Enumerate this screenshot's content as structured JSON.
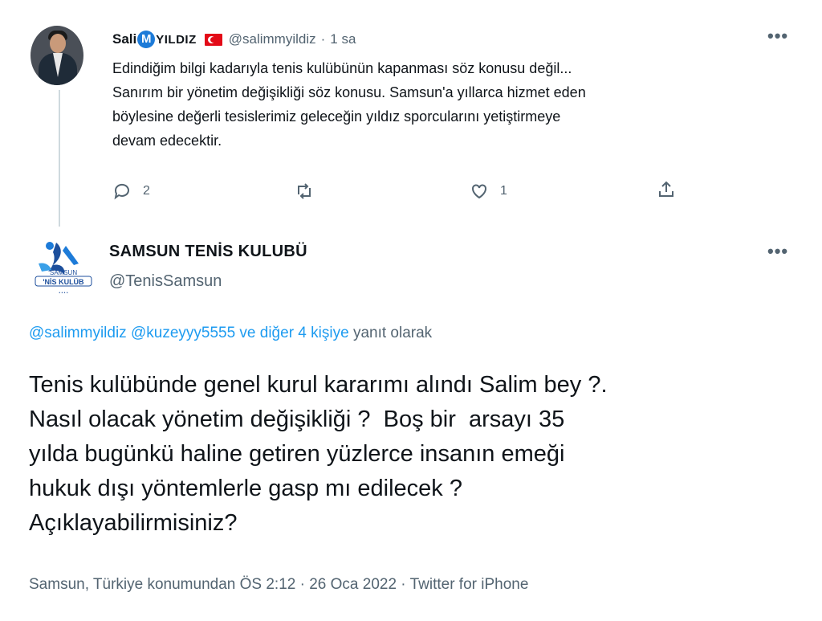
{
  "tweet1": {
    "name_prefix": "Sali",
    "name_badge": "M",
    "name_suffix": "YILDIZ",
    "handle": "@salimmyildiz",
    "separator": "·",
    "time": "1 sa",
    "more": "•••",
    "text": "Edindiğim bilgi kadarıyla tenis kulübünün kapanması söz konusu değil...\nSanırım bir yönetim değişikliği söz konusu. Samsun'a yıllarca hizmet eden\nböylesine değerli tesislerimiz geleceğin yıldız sporcularını yetiştirmeye\ndevam edecektir.",
    "reply_count": "2",
    "like_count": "1",
    "icons": [
      "reply-icon",
      "retweet-icon",
      "like-icon",
      "share-icon"
    ]
  },
  "tweet2": {
    "name": "SAMSUN TENİS KULUBÜ",
    "handle": "@TenisSamsun",
    "more": "•••",
    "logo_text": "SAMSUN TENİS KULÜBÜ",
    "reply_mentions": "@salimmyildiz @kuzeyyy5555  ve diğer 4 kişiye",
    "reply_suffix": "yanıt olarak",
    "text": "Tenis kulübünde genel kurul kararımı alındı Salim bey ?.\nNasıl olacak yönetim değişikliği ?  Boş bir  arsayı 35\nyılda bugünkü haline getiren yüzlerce insanın emeği\nhukuk dışı yöntemlerle gasp mı edilecek ?\nAçıklayabilirmisiniz?",
    "meta": "Samsun, Türkiye konumundan ÖS 2:12 · 26 Oca 2022 · Twitter for iPhone"
  },
  "colors": {
    "link": "#1d9bf0",
    "secondary": "#536471",
    "text": "#0f1419",
    "flag": "#e30a17"
  }
}
